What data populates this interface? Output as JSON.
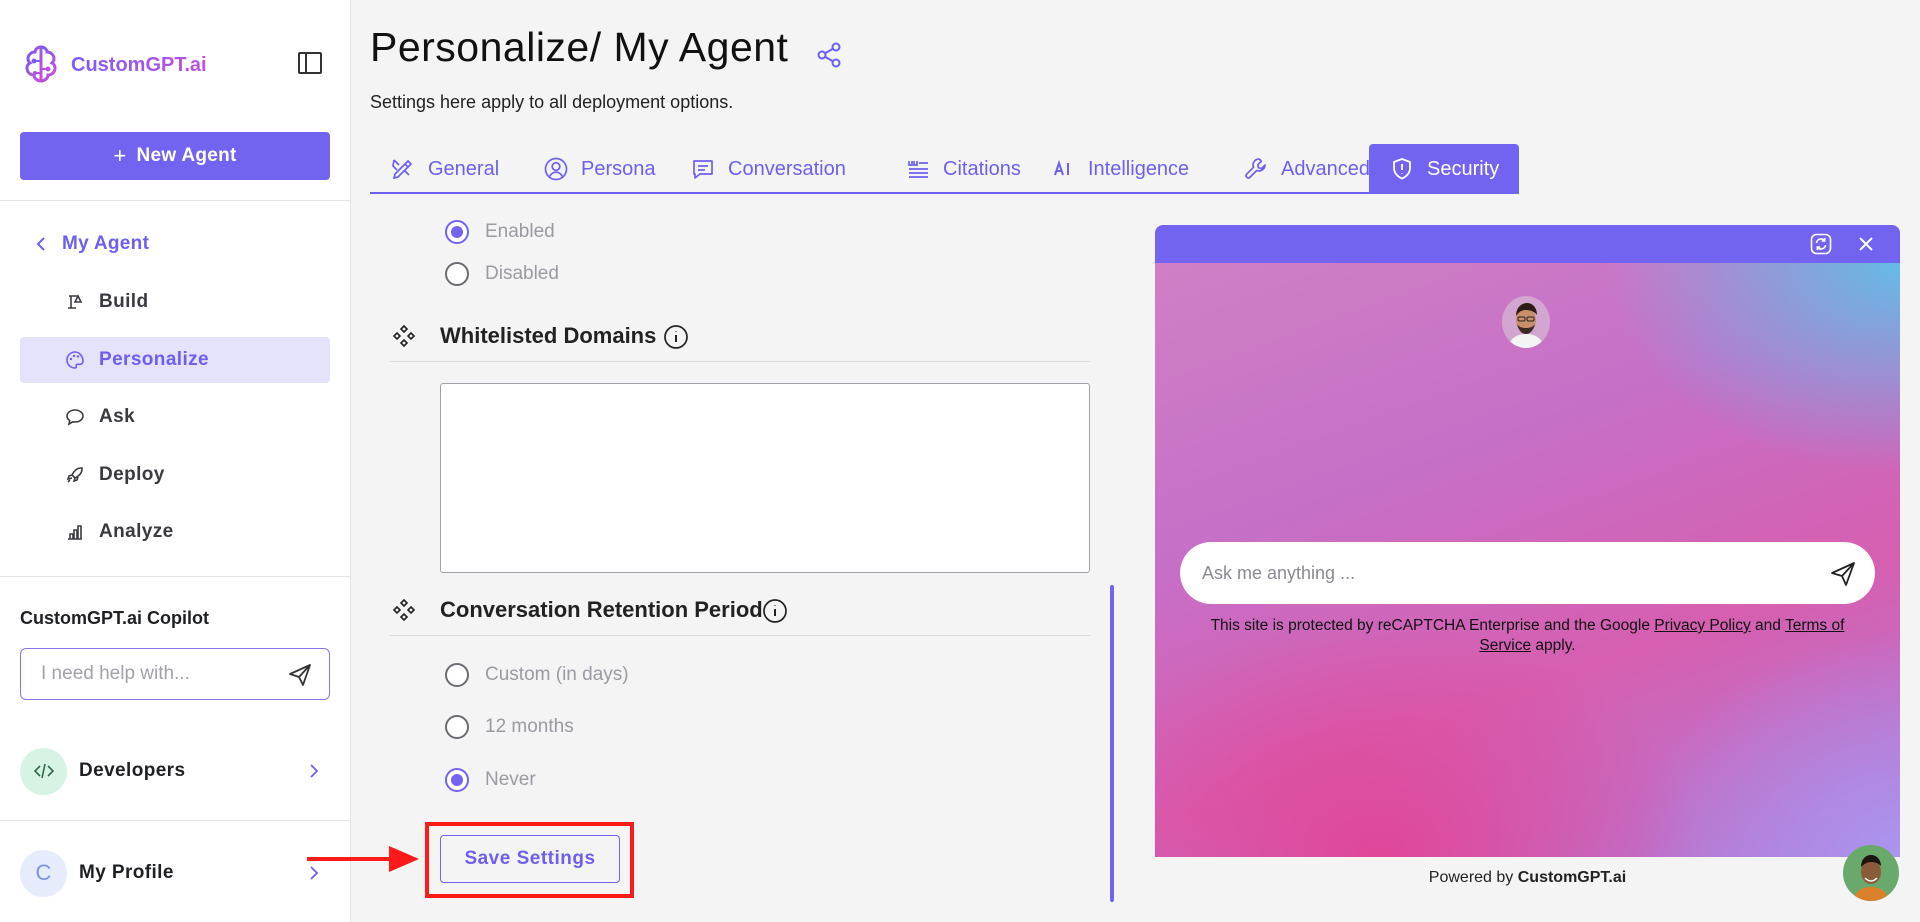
{
  "brand": {
    "name": "CustomGPT.ai",
    "accent": "#7263f0",
    "highlight": "#ff1a1a"
  },
  "sidebar": {
    "new_agent_label": "New Agent",
    "back_label": "My Agent",
    "items": [
      {
        "label": "Build",
        "icon": "build-icon"
      },
      {
        "label": "Personalize",
        "icon": "palette-icon",
        "active": true
      },
      {
        "label": "Ask",
        "icon": "chat-bubble-icon"
      },
      {
        "label": "Deploy",
        "icon": "rocket-icon"
      },
      {
        "label": "Analyze",
        "icon": "bar-chart-icon"
      }
    ],
    "copilot": {
      "title": "CustomGPT.ai Copilot",
      "placeholder": "I need help with..."
    },
    "developers_label": "Developers",
    "profile": {
      "initial": "C",
      "label": "My Profile"
    }
  },
  "header": {
    "title": "Personalize/ My Agent",
    "subtitle": "Settings here apply to all deployment options."
  },
  "tabs": [
    {
      "label": "General",
      "icon": "pencil-ruler-icon"
    },
    {
      "label": "Persona",
      "icon": "user-circle-icon"
    },
    {
      "label": "Conversation",
      "icon": "message-icon"
    },
    {
      "label": "Citations",
      "icon": "quote-list-icon"
    },
    {
      "label": "Intelligence",
      "icon": "ai-icon"
    },
    {
      "label": "Advanced",
      "icon": "wrench-icon"
    },
    {
      "label": "Security",
      "icon": "shield-icon",
      "active": true
    }
  ],
  "security": {
    "toggle_options": [
      {
        "label": "Enabled",
        "selected": true
      },
      {
        "label": "Disabled",
        "selected": false
      }
    ],
    "whitelisted_domains": {
      "title": "Whitelisted Domains",
      "value": ""
    },
    "retention": {
      "title": "Conversation Retention Period",
      "options": [
        {
          "label": "Custom (in days)",
          "selected": false
        },
        {
          "label": "12 months",
          "selected": false
        },
        {
          "label": "Never",
          "selected": true
        }
      ]
    },
    "save_label": "Save Settings"
  },
  "preview": {
    "ask_placeholder": "Ask me anything ...",
    "recaptcha_prefix": "This site is protected by reCAPTCHA Enterprise and the Google ",
    "privacy_link": "Privacy Policy",
    "recaptcha_and": " and ",
    "terms_link": "Terms of Service",
    "recaptcha_suffix": " apply.",
    "powered_prefix": "Powered by ",
    "powered_brand": "CustomGPT.ai"
  }
}
